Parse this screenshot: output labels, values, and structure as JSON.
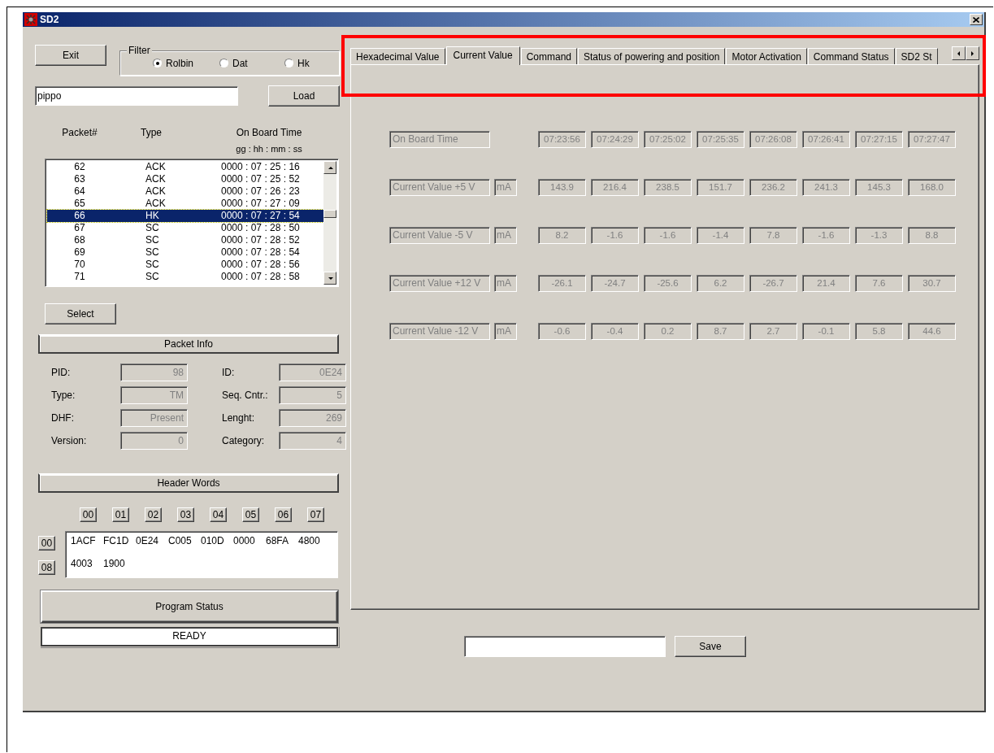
{
  "window": {
    "title": "SD2"
  },
  "exit_button": "Exit",
  "filter": {
    "label": "Filter",
    "options": [
      {
        "label": "Rolbin",
        "selected": true
      },
      {
        "label": "Dat",
        "selected": false
      },
      {
        "label": "Hk",
        "selected": false
      }
    ]
  },
  "file_field": {
    "value": "pippo"
  },
  "load_button": "Load",
  "packet_list": {
    "columns": [
      "Packet#",
      "Type",
      "On Board Time"
    ],
    "time_format": "gg : hh : mm : ss",
    "rows": [
      {
        "packet": "62",
        "type": "ACK",
        "time": "0000 : 07 : 25 : 16",
        "selected": false
      },
      {
        "packet": "63",
        "type": "ACK",
        "time": "0000 : 07 : 25 : 52",
        "selected": false
      },
      {
        "packet": "64",
        "type": "ACK",
        "time": "0000 : 07 : 26 : 23",
        "selected": false
      },
      {
        "packet": "65",
        "type": "ACK",
        "time": "0000 : 07 : 27 : 09",
        "selected": false
      },
      {
        "packet": "66",
        "type": "HK",
        "time": "0000 : 07 : 27 : 54",
        "selected": true
      },
      {
        "packet": "67",
        "type": "SC",
        "time": "0000 : 07 : 28 : 50",
        "selected": false
      },
      {
        "packet": "68",
        "type": "SC",
        "time": "0000 : 07 : 28 : 52",
        "selected": false
      },
      {
        "packet": "69",
        "type": "SC",
        "time": "0000 : 07 : 28 : 54",
        "selected": false
      },
      {
        "packet": "70",
        "type": "SC",
        "time": "0000 : 07 : 28 : 56",
        "selected": false
      },
      {
        "packet": "71",
        "type": "SC",
        "time": "0000 : 07 : 28 : 58",
        "selected": false
      }
    ]
  },
  "select_button": "Select",
  "packet_info": {
    "title": "Packet Info",
    "fields": [
      {
        "label": "PID:",
        "value": "98"
      },
      {
        "label": "ID:",
        "value": "0E24"
      },
      {
        "label": "Type:",
        "value": "TM"
      },
      {
        "label": "Seq. Cntr.:",
        "value": "5"
      },
      {
        "label": "DHF:",
        "value": "Present"
      },
      {
        "label": "Lenght:",
        "value": "269"
      },
      {
        "label": "Version:",
        "value": "0"
      },
      {
        "label": "Category:",
        "value": "4"
      }
    ]
  },
  "header_words": {
    "title": "Header Words",
    "column_buttons": [
      "00",
      "01",
      "02",
      "03",
      "04",
      "05",
      "06",
      "07"
    ],
    "row_buttons": [
      "00",
      "08"
    ],
    "rows": [
      [
        "1ACF",
        "FC1D",
        "0E24",
        "C005",
        "010D",
        "0000",
        "68FA",
        "4800"
      ],
      [
        "4003",
        "1900"
      ]
    ]
  },
  "program_status": {
    "title": "Program Status",
    "value": "READY"
  },
  "tabs": [
    {
      "label": "Hexadecimal Value",
      "selected": false
    },
    {
      "label": "Current Value",
      "selected": true
    },
    {
      "label": "Command",
      "selected": false
    },
    {
      "label": "Status of powering and position",
      "selected": false
    },
    {
      "label": "Motor Activation",
      "selected": false
    },
    {
      "label": "Command Status",
      "selected": false
    },
    {
      "label": "SD2 St",
      "selected": false
    }
  ],
  "current_values": {
    "rows": [
      {
        "label": "On Board Time",
        "values": [
          "07:23:56",
          "07:24:29",
          "07:25:02",
          "07:25:35",
          "07:26:08",
          "07:26:41",
          "07:27:15",
          "07:27:47"
        ]
      },
      {
        "label": "Current Value +5 V",
        "unit": "mA",
        "values": [
          "143.9",
          "216.4",
          "238.5",
          "151.7",
          "236.2",
          "241.3",
          "145.3",
          "168.0"
        ]
      },
      {
        "label": "Current Value -5 V",
        "unit": "mA",
        "values": [
          "8.2",
          "-1.6",
          "-1.6",
          "-1.4",
          "7.8",
          "-1.6",
          "-1.3",
          "8.8"
        ]
      },
      {
        "label": "Current Value +12 V",
        "unit": "mA",
        "values": [
          "-26.1",
          "-24.7",
          "-25.6",
          "6.2",
          "-26.7",
          "21.4",
          "7.6",
          "30.7"
        ]
      },
      {
        "label": "Current Value -12 V",
        "unit": "mA",
        "values": [
          "-0.6",
          "-0.4",
          "0.2",
          "8.7",
          "2.7",
          "-0.1",
          "5.8",
          "44.6"
        ]
      }
    ]
  },
  "save_button": "Save"
}
